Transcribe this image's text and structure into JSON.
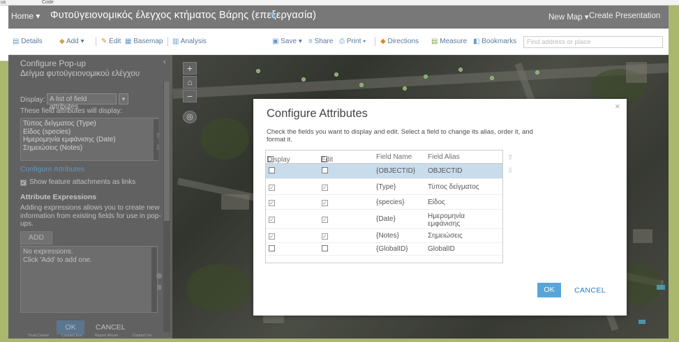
{
  "browser_strip": {
    "left_text": "us",
    "code_text": "Code"
  },
  "header": {
    "home_label": "Home ▾",
    "map_title": "Φυτοϋγειονομικός έλεγχος κτήματος Βάρης (επεξεργασία)",
    "new_map_label": "New Map ▾",
    "create_presentation_label": "Create Presentation"
  },
  "toolbar": {
    "details_label": "Details",
    "add_label": "Add ▾",
    "edit_label": "Edit",
    "basemap_label": "Basemap",
    "analysis_label": "Analysis",
    "save_label": "Save ▾",
    "share_label": "Share",
    "print_label": "Print ▾",
    "directions_label": "Directions",
    "measure_label": "Measure",
    "bookmarks_label": "Bookmarks",
    "address_placeholder": "Find address or place"
  },
  "popup_panel": {
    "title": "Configure Pop-up",
    "layer_name": "Δείγμα φυτοϋγειονομικού ελέγχου",
    "display_label": "Display:",
    "display_value": "A list of field attributes",
    "display_arrow": "▾",
    "fields_caption": "These field attributes will display:",
    "field_list": [
      "Τύπος δείγματος (Type)",
      "Είδος (species)",
      "Ημερομηνία εμφάνισης (Date)",
      "Σημειώσεις (Notes)"
    ],
    "configure_attributes_link": "Configure Attributes",
    "show_attachments_label": "Show feature attachments as links",
    "attribute_expressions_heading": "Attribute Expressions",
    "attribute_expressions_desc": "Adding expressions allows you to create new information from existing fields for use in pop-ups.",
    "add_button_label": "ADD",
    "expressions_empty_line1": "No expressions.",
    "expressions_empty_line2": "Click 'Add' to add one.",
    "ok_label": "OK",
    "cancel_label": "CANCEL",
    "footer_links": [
      "Trust Center",
      "Contact Esri",
      "Report Abuse",
      "Contact Us"
    ]
  },
  "map_controls": {
    "zoom_in": "+",
    "home": "⌂",
    "zoom_out": "−"
  },
  "dialog": {
    "title": "Configure Attributes",
    "description": "Check the fields you want to display and edit. Select a field to change its alias, order it, and format it.",
    "close_glyph": "×",
    "columns": {
      "display": "Display",
      "edit": "Edit",
      "field_name": "Field Name",
      "field_alias": "Field Alias"
    },
    "rows": [
      {
        "display": false,
        "edit": false,
        "field_name": "{OBJECTID}",
        "field_alias": "OBJECTID",
        "selected": true
      },
      {
        "display": true,
        "edit": true,
        "field_name": "{Type}",
        "field_alias": "Τύπος δείγματος",
        "selected": false
      },
      {
        "display": true,
        "edit": true,
        "field_name": "{species}",
        "field_alias": "Είδος",
        "selected": false
      },
      {
        "display": true,
        "edit": true,
        "field_name": "{Date}",
        "field_alias": "Ημερομηνία εμφάνισης",
        "selected": false
      },
      {
        "display": true,
        "edit": true,
        "field_name": "{Notes}",
        "field_alias": "Σημειώσεις",
        "selected": false
      },
      {
        "display": false,
        "edit": false,
        "field_name": "{GlobalID}",
        "field_alias": "GlobalID",
        "selected": false
      }
    ],
    "ok_label": "OK",
    "cancel_label": "CANCEL"
  },
  "colors": {
    "header_bg": "#787878",
    "panel_bg": "#777777",
    "accent_blue": "#59a5d8",
    "link_blue": "#2a79b8",
    "selected_row": "#c9dcec"
  }
}
